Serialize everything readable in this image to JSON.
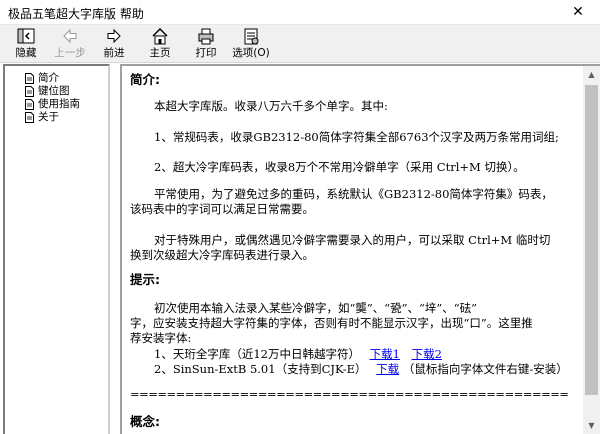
{
  "window": {
    "title": "极品五笔超大字库版 帮助",
    "close_glyph": "✕"
  },
  "toolbar": {
    "hide": "隐藏",
    "back": "上一步",
    "forward": "前进",
    "home": "主页",
    "print": "打印",
    "options": "选项(O)"
  },
  "tree": {
    "items": [
      "简介",
      "键位图",
      "使用指南",
      "关于"
    ]
  },
  "content": {
    "intro_title": "简介:",
    "intro_p1": "本超大字库版。收录八万六千多个单字。其中:",
    "intro_p2": "1、常规码表，收录GB2312-80简体字符集全部6763个汉字及两万条常用词组;",
    "intro_p3": "2、超大冷字库码表，收录8万个不常用冷僻单字（采用 Ctrl+M 切换）。",
    "intro_p4_l1": "平常使用，为了避免过多的重码，系统默认《GB2312-80简体字符集》码表，",
    "intro_p4_l2": "该码表中的字词可以满足日常需要。",
    "intro_p5_l1": "对于特殊用户，或偶然遇见冷僻字需要录入的用户，可以采取 Ctrl+M 临时切",
    "intro_p5_l2": "换到次级超大冷字库码表进行录入。",
    "tip_title": "提示:",
    "tip_p1_l1": "初次使用本输入法录入某些冷僻字，如“龑”、“㼦”、“垶”、“砝”",
    "tip_p1_l2": "字，应安装支持超大字符集的字体，否则有时不能显示汉字，出现“口”。这里推",
    "tip_p1_l3": "荐安装字体:",
    "font1_text": "1、天珩全字库（近12万中日韩越字符）",
    "font1_link1": "下载1",
    "font1_link2": "下载2",
    "font2_text": "2、SinSun-ExtB 5.01（支持到CJK-E）",
    "font2_link": "下载",
    "font2_note": "（鼠标指向字体文件右键-安装）",
    "separator": "================================================",
    "concept_title": "概念:"
  },
  "colors": {
    "link": "#0000ee",
    "toolbar_bg": "#f0f0f0"
  }
}
